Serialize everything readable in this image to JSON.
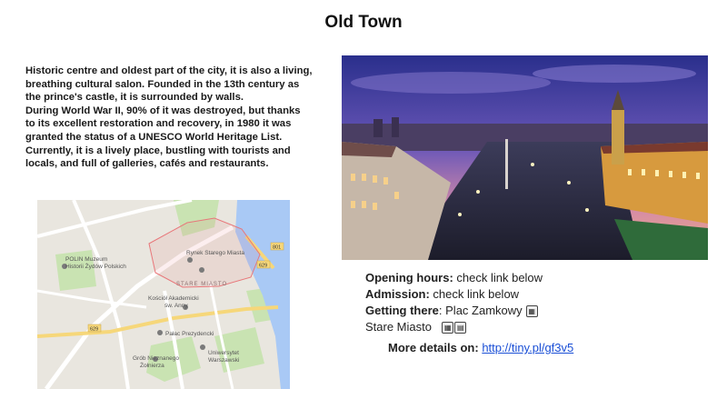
{
  "page": {
    "title": "Old Town"
  },
  "description": {
    "lines": [
      "Historic centre and oldest part of the city, it is also a living,",
      "breathing cultural salon. Founded in the 13th century as",
      "the prince's castle, it is surrounded by walls.",
      "During World War II, 90% of it was destroyed, but thanks",
      "to its excellent restoration and recovery, in 1980 it was",
      "granted the status of a UNESCO World Heritage List.",
      "Currently, it is a lively place, bustling with tourists and",
      "locals, and full of galleries, cafés and restaurants."
    ]
  },
  "map": {
    "labels": {
      "polin_1": "POLIN Muzeum",
      "polin_2": "Historii Żydów Polskich",
      "rynek_1": "Rynek Starego Miasta",
      "stare_miasto": "STARE MIASTO",
      "kosciol_1": "Kościół Akademicki",
      "kosciol_2": "św. Anny",
      "palac": "Pałac Prezydencki",
      "grob_1": "Grób Nieznanego",
      "grob_2": "Żołnierza",
      "uniwersytet_1": "Uniwersytet",
      "uniwersytet_2": "Warszawski",
      "road_801": "801",
      "road_629a": "629",
      "road_629b": "629"
    },
    "colors": {
      "background": "#e9e6df",
      "park": "#c9e3b2",
      "water": "#a9c9f5",
      "road": "#ffffff",
      "highway": "#f6d77a",
      "outline": "#e8777a"
    }
  },
  "info": {
    "opening_label": "Opening hours:",
    "opening_value": " check link below",
    "admission_label": "Admission:",
    "admission_value": " check link below",
    "getting_label": "Getting there",
    "getting_value": ": Plac Zamkowy",
    "stop2": "Stare Miasto",
    "transport_icons": [
      "tram-icon",
      "bus-icon"
    ]
  },
  "more": {
    "label": "More details on:",
    "link": "http://tiny.pl/gf3v5"
  }
}
